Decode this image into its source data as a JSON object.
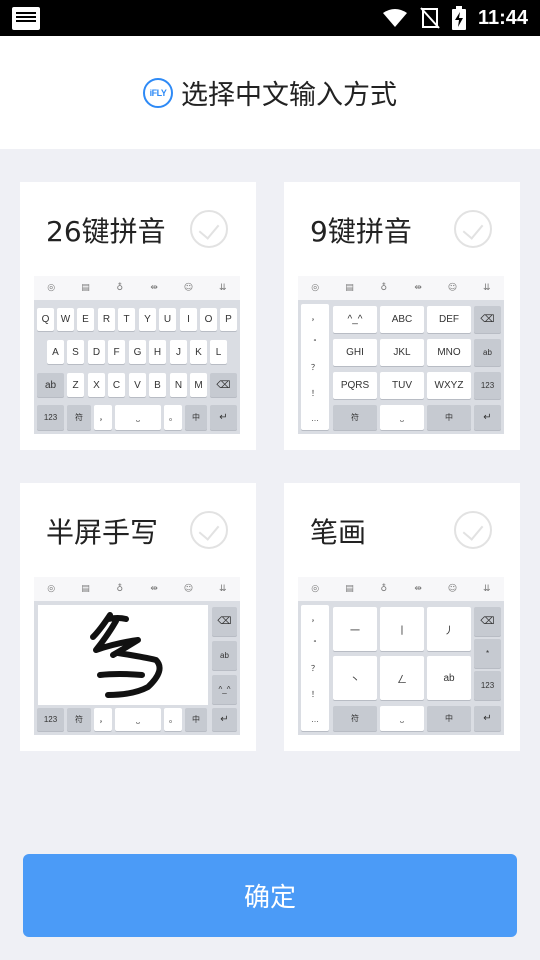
{
  "status": {
    "time": "11:44"
  },
  "header": {
    "logo_text": "iFLY",
    "title": "选择中文输入方式"
  },
  "options": [
    {
      "label": "26键拼音",
      "selected": false
    },
    {
      "label": "9键拼音",
      "selected": false
    },
    {
      "label": "半屏手写",
      "selected": false
    },
    {
      "label": "笔画",
      "selected": false
    }
  ],
  "kb26": {
    "row1": [
      "Q",
      "W",
      "E",
      "R",
      "T",
      "Y",
      "U",
      "I",
      "O",
      "P"
    ],
    "row2": [
      "A",
      "S",
      "D",
      "F",
      "G",
      "H",
      "J",
      "K",
      "L"
    ],
    "row3": [
      "Z",
      "X",
      "C",
      "V",
      "B",
      "N",
      "M"
    ],
    "ab": "ab",
    "num": "123",
    "sym": "符",
    "comma": "，",
    "period": "。",
    "lang": "中"
  },
  "kb9": {
    "side": [
      "，",
      "“",
      "？",
      "！",
      "…"
    ],
    "keys": [
      "^_^",
      "ABC",
      "DEF",
      "GHI",
      "JKL",
      "MNO",
      "PQRS",
      "TUV",
      "WXYZ"
    ],
    "ab": "ab",
    "num": "123",
    "sym": "符",
    "lang": "中"
  },
  "kbhw": {
    "ab": "ab",
    "emo": "^_^",
    "num": "123",
    "sym": "符",
    "comma": "，",
    "period": "。",
    "lang": "中"
  },
  "kbstroke": {
    "side": [
      "，",
      "“",
      "？",
      "！",
      "…"
    ],
    "keys": [
      "一",
      "丨",
      "丿",
      "丶",
      "ㄥ",
      "ab"
    ],
    "star": "*",
    "num": "123",
    "sym": "符",
    "lang": "中"
  },
  "confirm_label": "确定",
  "colors": {
    "accent": "#4b9bf7",
    "logo": "#2e8af6"
  }
}
